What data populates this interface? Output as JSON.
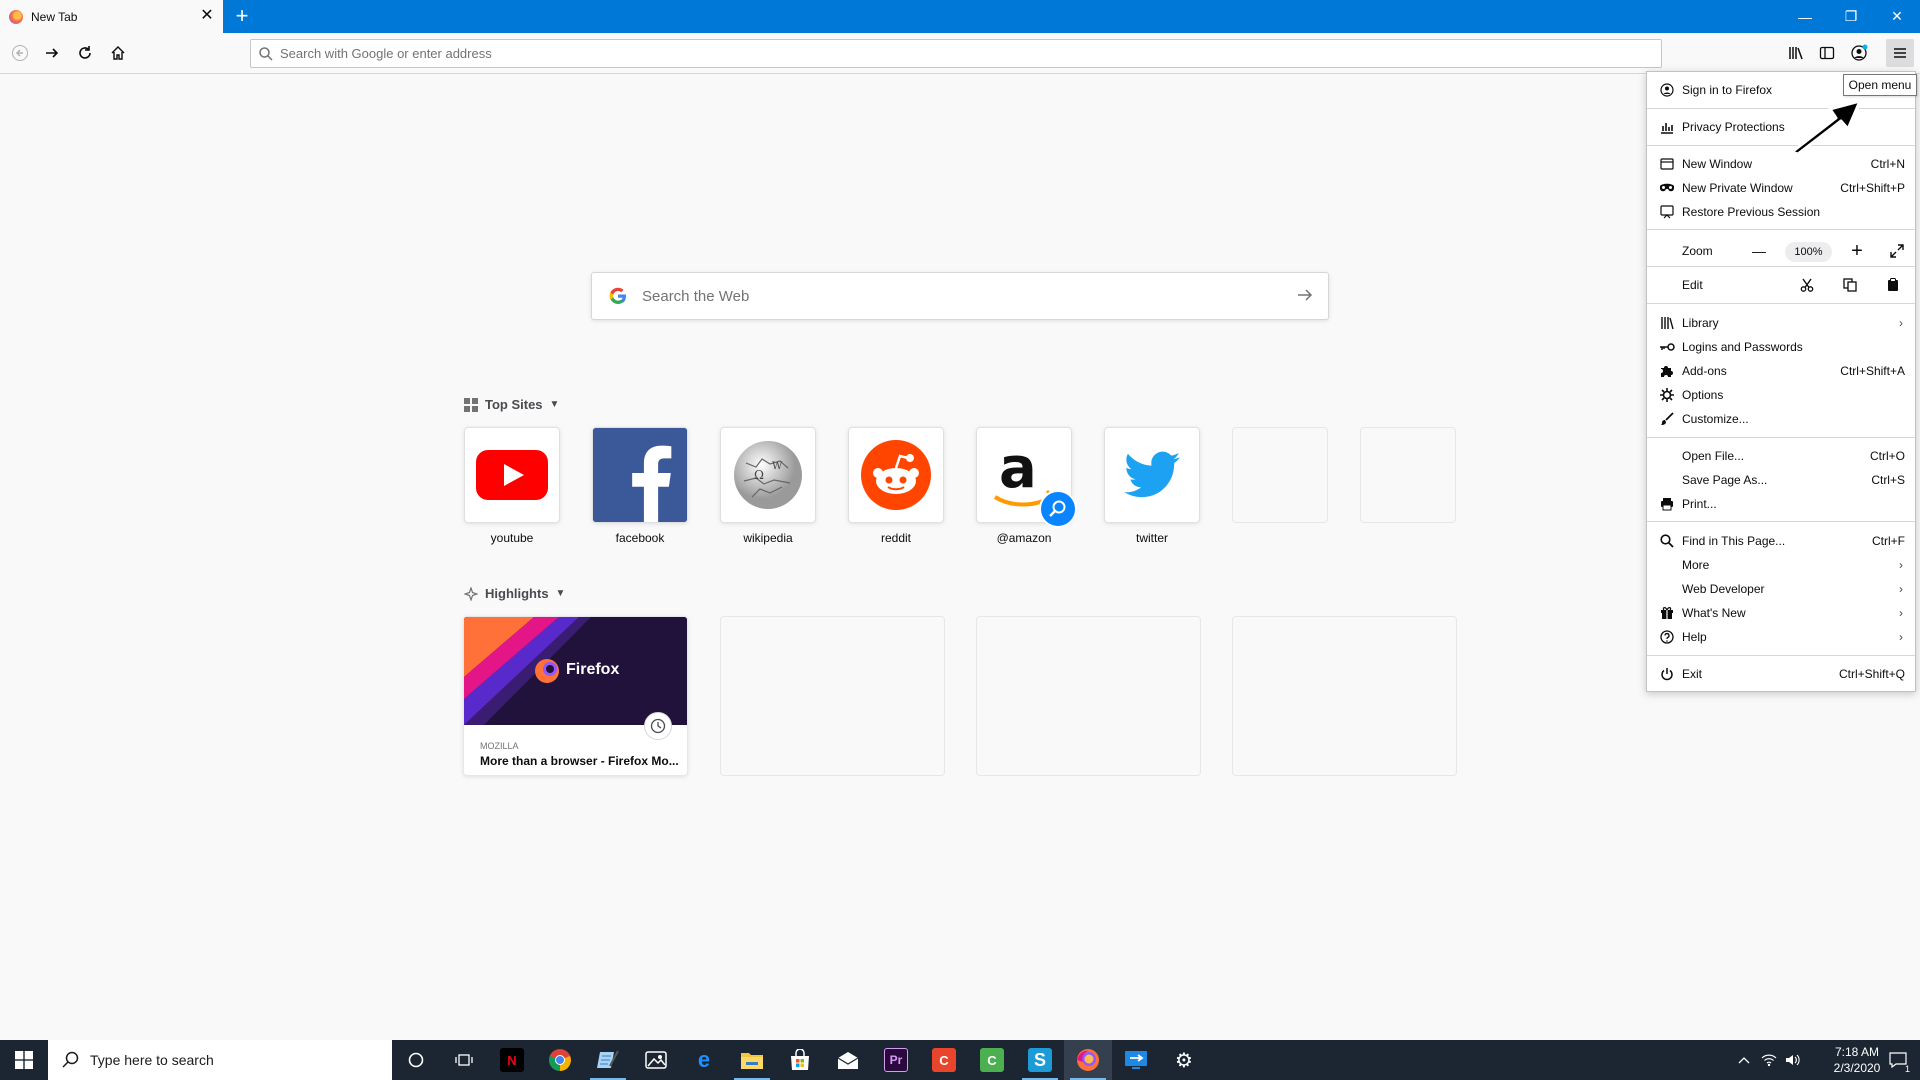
{
  "browser": {
    "tab": {
      "title": "New Tab",
      "close": "✕"
    },
    "new_tab_symbol": "+",
    "window_controls": {
      "minimize": "—",
      "restore": "❐",
      "close": "✕"
    },
    "urlbar": {
      "placeholder": "Search with Google or enter address",
      "value": ""
    },
    "tooltip": "Open menu"
  },
  "newtab": {
    "search": {
      "placeholder": "Search the Web"
    },
    "top_sites": {
      "heading": "Top Sites",
      "sites": [
        {
          "label": "youtube",
          "icon": "youtube-icon"
        },
        {
          "label": "facebook",
          "icon": "facebook-icon"
        },
        {
          "label": "wikipedia",
          "icon": "wikipedia-icon"
        },
        {
          "label": "reddit",
          "icon": "reddit-icon"
        },
        {
          "label": "@amazon",
          "icon": "amazon-icon"
        },
        {
          "label": "twitter",
          "icon": "twitter-icon"
        }
      ]
    },
    "highlights": {
      "heading": "Highlights",
      "card": {
        "brand_text": "Firefox",
        "source": "MOZILLA",
        "title": "More than a browser - Firefox Mo..."
      }
    }
  },
  "app_menu": {
    "items": [
      {
        "label": "Sign in to Firefox",
        "icon": "account-icon",
        "shortcut": ""
      },
      {
        "label": "Privacy Protections",
        "icon": "dashboard-icon",
        "shortcut": ""
      },
      {
        "label": "New Window",
        "icon": "new-window-icon",
        "shortcut": "Ctrl+N"
      },
      {
        "label": "New Private Window",
        "icon": "private-browsing-icon",
        "shortcut": "Ctrl+Shift+P"
      },
      {
        "label": "Restore Previous Session",
        "icon": "restore-session-icon",
        "shortcut": ""
      },
      {
        "label": "Zoom",
        "icon": "",
        "shortcut": ""
      },
      {
        "label": "Edit",
        "icon": "",
        "shortcut": ""
      },
      {
        "label": "Library",
        "icon": "library-icon",
        "shortcut": ""
      },
      {
        "label": "Logins and Passwords",
        "icon": "key-icon",
        "shortcut": ""
      },
      {
        "label": "Add-ons",
        "icon": "puzzle-icon",
        "shortcut": "Ctrl+Shift+A"
      },
      {
        "label": "Options",
        "icon": "gear-icon",
        "shortcut": ""
      },
      {
        "label": "Customize...",
        "icon": "brush-icon",
        "shortcut": ""
      },
      {
        "label": "Open File...",
        "icon": "",
        "shortcut": "Ctrl+O"
      },
      {
        "label": "Save Page As...",
        "icon": "",
        "shortcut": "Ctrl+S"
      },
      {
        "label": "Print...",
        "icon": "printer-icon",
        "shortcut": ""
      },
      {
        "label": "Find in This Page...",
        "icon": "search-icon",
        "shortcut": "Ctrl+F"
      },
      {
        "label": "More",
        "icon": "",
        "shortcut": ""
      },
      {
        "label": "Web Developer",
        "icon": "",
        "shortcut": ""
      },
      {
        "label": "What's New",
        "icon": "gift-icon",
        "shortcut": ""
      },
      {
        "label": "Help",
        "icon": "help-icon",
        "shortcut": ""
      },
      {
        "label": "Exit",
        "icon": "power-icon",
        "shortcut": "Ctrl+Shift+Q"
      }
    ],
    "zoom": {
      "minus": "—",
      "value": "100%",
      "plus": "+"
    }
  },
  "taskbar": {
    "search_placeholder": "Type here to search",
    "clock_time": "7:18 AM",
    "clock_date": "2/3/2020",
    "notification_count": "1",
    "apps": [
      {
        "name": "netflix-icon",
        "letter": "N",
        "color": "#e50914"
      },
      {
        "name": "chrome-icon",
        "letter": "",
        "color": "#4285f4"
      },
      {
        "name": "notepad-icon",
        "letter": "",
        "color": "#7eb6e6"
      },
      {
        "name": "photos-icon",
        "letter": "",
        "color": "#ffffff"
      },
      {
        "name": "edge-icon",
        "letter": "e",
        "color": "#0078d7"
      },
      {
        "name": "file-explorer-icon",
        "letter": "",
        "color": "#f6c343"
      },
      {
        "name": "store-icon",
        "letter": "",
        "color": "#ffffff"
      },
      {
        "name": "mail-icon",
        "letter": "",
        "color": "#ffffff"
      },
      {
        "name": "premiere-icon",
        "letter": "Pr",
        "color": "#2a0a3c"
      },
      {
        "name": "camtasia-red-icon",
        "letter": "C",
        "color": "#e8452c"
      },
      {
        "name": "camtasia-green-icon",
        "letter": "C",
        "color": "#4caf50"
      },
      {
        "name": "snagit-icon",
        "letter": "S",
        "color": "#1d9bd7"
      },
      {
        "name": "firefox-icon",
        "letter": "",
        "color": "#ff7139"
      },
      {
        "name": "remote-desktop-icon",
        "letter": "",
        "color": "#1e88e5"
      },
      {
        "name": "settings-icon",
        "letter": "⚙",
        "color": "transparent"
      }
    ]
  }
}
